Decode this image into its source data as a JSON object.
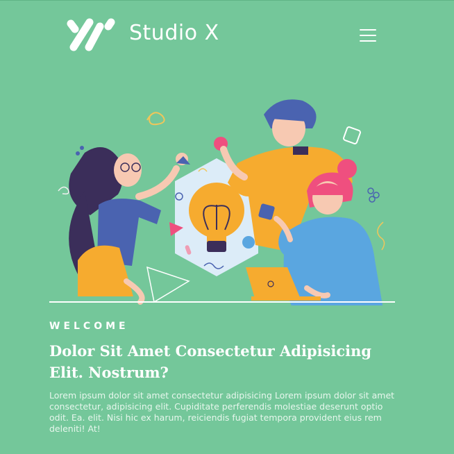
{
  "header": {
    "brand_name": "Studio X",
    "logo_icon": "slash-stripes-logo-icon",
    "menu_icon": "hamburger-menu-icon"
  },
  "hero": {
    "illustration": "team-brainstorm-lightbulb-illustration"
  },
  "content": {
    "eyebrow": "WELCOME",
    "headline": "Dolor Sit Amet Consectetur Adipisicing Elit. Nostrum?",
    "body": "Lorem ipsum dolor sit amet consectetur adipisicing Lorem ipsum dolor sit amet consectetur, adipisicing elit. Cupiditate perferendis molestiae deserunt optio odit. Ea. elit. Nisi hic ex harum, reiciendis fugiat tempora provident eius rem deleniti! At!"
  },
  "colors": {
    "background": "#74c79a",
    "text": "#ffffff",
    "accent_orange": "#f6ab2f",
    "accent_blue": "#4a63b0",
    "accent_pink": "#ef4f7f",
    "light_blue": "#dcecf8"
  }
}
